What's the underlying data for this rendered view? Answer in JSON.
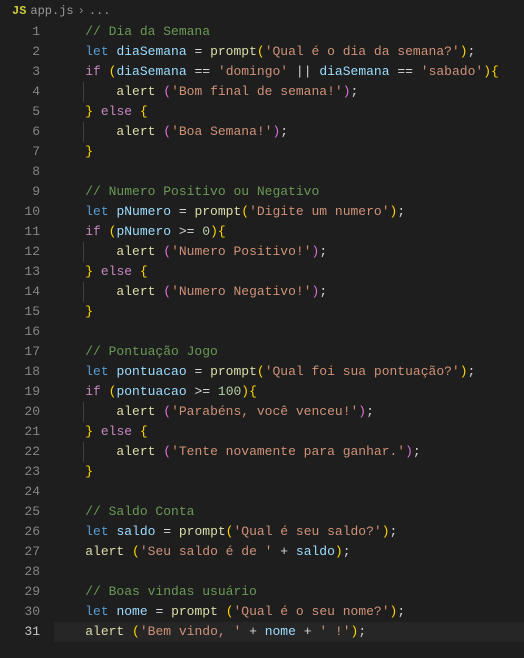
{
  "breadcrumb": {
    "js_badge": "JS",
    "filename": "app.js",
    "chevron": "›",
    "ellipsis": "..."
  },
  "lines": [
    {
      "n": 1,
      "indent": 0,
      "tokens": [
        [
          "cm",
          "// Dia da Semana"
        ]
      ]
    },
    {
      "n": 2,
      "indent": 0,
      "tokens": [
        [
          "kw",
          "let"
        ],
        [
          "op",
          " "
        ],
        [
          "vr",
          "diaSemana"
        ],
        [
          "op",
          " = "
        ],
        [
          "fn",
          "prompt"
        ],
        [
          "br-y",
          "("
        ],
        [
          "st",
          "'Qual é o dia da semana?'"
        ],
        [
          "br-y",
          ")"
        ],
        [
          "op",
          ";"
        ]
      ]
    },
    {
      "n": 3,
      "indent": 0,
      "tokens": [
        [
          "cf",
          "if"
        ],
        [
          "op",
          " "
        ],
        [
          "br-y",
          "("
        ],
        [
          "vr",
          "diaSemana"
        ],
        [
          "op",
          " == "
        ],
        [
          "st",
          "'domingo'"
        ],
        [
          "op",
          " || "
        ],
        [
          "vr",
          "diaSemana"
        ],
        [
          "op",
          " == "
        ],
        [
          "st",
          "'sabado'"
        ],
        [
          "br-y",
          ")"
        ],
        [
          "br-y",
          "{"
        ]
      ]
    },
    {
      "n": 4,
      "indent": 1,
      "tokens": [
        [
          "fn",
          "alert"
        ],
        [
          "op",
          " "
        ],
        [
          "br-p",
          "("
        ],
        [
          "st",
          "'Bom final de semana!'"
        ],
        [
          "br-p",
          ")"
        ],
        [
          "op",
          ";"
        ]
      ]
    },
    {
      "n": 5,
      "indent": 0,
      "tokens": [
        [
          "br-y",
          "}"
        ],
        [
          "op",
          " "
        ],
        [
          "cf",
          "else"
        ],
        [
          "op",
          " "
        ],
        [
          "br-y",
          "{"
        ]
      ]
    },
    {
      "n": 6,
      "indent": 1,
      "tokens": [
        [
          "fn",
          "alert"
        ],
        [
          "op",
          " "
        ],
        [
          "br-p",
          "("
        ],
        [
          "st",
          "'Boa Semana!'"
        ],
        [
          "br-p",
          ")"
        ],
        [
          "op",
          ";"
        ]
      ]
    },
    {
      "n": 7,
      "indent": 0,
      "tokens": [
        [
          "br-y",
          "}"
        ]
      ]
    },
    {
      "n": 8,
      "indent": 0,
      "tokens": []
    },
    {
      "n": 9,
      "indent": 0,
      "tokens": [
        [
          "cm",
          "// Numero Positivo ou Negativo"
        ]
      ]
    },
    {
      "n": 10,
      "indent": 0,
      "tokens": [
        [
          "kw",
          "let"
        ],
        [
          "op",
          " "
        ],
        [
          "vr",
          "pNumero"
        ],
        [
          "op",
          " = "
        ],
        [
          "fn",
          "prompt"
        ],
        [
          "br-y",
          "("
        ],
        [
          "st",
          "'Digite um numero'"
        ],
        [
          "br-y",
          ")"
        ],
        [
          "op",
          ";"
        ]
      ]
    },
    {
      "n": 11,
      "indent": 0,
      "tokens": [
        [
          "cf",
          "if"
        ],
        [
          "op",
          " "
        ],
        [
          "br-y",
          "("
        ],
        [
          "vr",
          "pNumero"
        ],
        [
          "op",
          " >= "
        ],
        [
          "nm",
          "0"
        ],
        [
          "br-y",
          ")"
        ],
        [
          "br-y",
          "{"
        ]
      ]
    },
    {
      "n": 12,
      "indent": 1,
      "tokens": [
        [
          "fn",
          "alert"
        ],
        [
          "op",
          " "
        ],
        [
          "br-p",
          "("
        ],
        [
          "st",
          "'Numero Positivo!'"
        ],
        [
          "br-p",
          ")"
        ],
        [
          "op",
          ";"
        ]
      ]
    },
    {
      "n": 13,
      "indent": 0,
      "tokens": [
        [
          "br-y",
          "}"
        ],
        [
          "op",
          " "
        ],
        [
          "cf",
          "else"
        ],
        [
          "op",
          " "
        ],
        [
          "br-y",
          "{"
        ]
      ]
    },
    {
      "n": 14,
      "indent": 1,
      "tokens": [
        [
          "fn",
          "alert"
        ],
        [
          "op",
          " "
        ],
        [
          "br-p",
          "("
        ],
        [
          "st",
          "'Numero Negativo!'"
        ],
        [
          "br-p",
          ")"
        ],
        [
          "op",
          ";"
        ]
      ]
    },
    {
      "n": 15,
      "indent": 0,
      "tokens": [
        [
          "br-y",
          "}"
        ]
      ]
    },
    {
      "n": 16,
      "indent": 0,
      "tokens": []
    },
    {
      "n": 17,
      "indent": 0,
      "tokens": [
        [
          "cm",
          "// Pontuação Jogo"
        ]
      ]
    },
    {
      "n": 18,
      "indent": 0,
      "tokens": [
        [
          "kw",
          "let"
        ],
        [
          "op",
          " "
        ],
        [
          "vr",
          "pontuacao"
        ],
        [
          "op",
          " = "
        ],
        [
          "fn",
          "prompt"
        ],
        [
          "br-y",
          "("
        ],
        [
          "st",
          "'Qual foi sua pontuação?'"
        ],
        [
          "br-y",
          ")"
        ],
        [
          "op",
          ";"
        ]
      ]
    },
    {
      "n": 19,
      "indent": 0,
      "tokens": [
        [
          "cf",
          "if"
        ],
        [
          "op",
          " "
        ],
        [
          "br-y",
          "("
        ],
        [
          "vr",
          "pontuacao"
        ],
        [
          "op",
          " >= "
        ],
        [
          "nm",
          "100"
        ],
        [
          "br-y",
          ")"
        ],
        [
          "br-y",
          "{"
        ]
      ]
    },
    {
      "n": 20,
      "indent": 1,
      "tokens": [
        [
          "fn",
          "alert"
        ],
        [
          "op",
          " "
        ],
        [
          "br-p",
          "("
        ],
        [
          "st",
          "'Parabéns, você venceu!'"
        ],
        [
          "br-p",
          ")"
        ],
        [
          "op",
          ";"
        ]
      ]
    },
    {
      "n": 21,
      "indent": 0,
      "tokens": [
        [
          "br-y",
          "}"
        ],
        [
          "op",
          " "
        ],
        [
          "cf",
          "else"
        ],
        [
          "op",
          " "
        ],
        [
          "br-y",
          "{"
        ]
      ]
    },
    {
      "n": 22,
      "indent": 1,
      "tokens": [
        [
          "fn",
          "alert"
        ],
        [
          "op",
          " "
        ],
        [
          "br-p",
          "("
        ],
        [
          "st",
          "'Tente novamente para ganhar.'"
        ],
        [
          "br-p",
          ")"
        ],
        [
          "op",
          ";"
        ]
      ]
    },
    {
      "n": 23,
      "indent": 0,
      "tokens": [
        [
          "br-y",
          "}"
        ]
      ]
    },
    {
      "n": 24,
      "indent": 0,
      "tokens": []
    },
    {
      "n": 25,
      "indent": 0,
      "tokens": [
        [
          "cm",
          "// Saldo Conta"
        ]
      ]
    },
    {
      "n": 26,
      "indent": 0,
      "tokens": [
        [
          "kw",
          "let"
        ],
        [
          "op",
          " "
        ],
        [
          "vr",
          "saldo"
        ],
        [
          "op",
          " = "
        ],
        [
          "fn",
          "prompt"
        ],
        [
          "br-y",
          "("
        ],
        [
          "st",
          "'Qual é seu saldo?'"
        ],
        [
          "br-y",
          ")"
        ],
        [
          "op",
          ";"
        ]
      ]
    },
    {
      "n": 27,
      "indent": 0,
      "tokens": [
        [
          "fn",
          "alert"
        ],
        [
          "op",
          " "
        ],
        [
          "br-y",
          "("
        ],
        [
          "st",
          "'Seu saldo é de '"
        ],
        [
          "op",
          " + "
        ],
        [
          "vr",
          "saldo"
        ],
        [
          "br-y",
          ")"
        ],
        [
          "op",
          ";"
        ]
      ]
    },
    {
      "n": 28,
      "indent": 0,
      "tokens": []
    },
    {
      "n": 29,
      "indent": 0,
      "tokens": [
        [
          "cm",
          "// Boas vindas usuário"
        ]
      ]
    },
    {
      "n": 30,
      "indent": 0,
      "tokens": [
        [
          "kw",
          "let"
        ],
        [
          "op",
          " "
        ],
        [
          "vr",
          "nome"
        ],
        [
          "op",
          " = "
        ],
        [
          "fn",
          "prompt"
        ],
        [
          "op",
          " "
        ],
        [
          "br-y",
          "("
        ],
        [
          "st",
          "'Qual é o seu nome?'"
        ],
        [
          "br-y",
          ")"
        ],
        [
          "op",
          ";"
        ]
      ]
    },
    {
      "n": 31,
      "indent": 0,
      "current": true,
      "tokens": [
        [
          "fn",
          "alert"
        ],
        [
          "op",
          " "
        ],
        [
          "br-y",
          "("
        ],
        [
          "st",
          "'Bem vindo, '"
        ],
        [
          "op",
          " + "
        ],
        [
          "vr",
          "nome"
        ],
        [
          "op",
          " + "
        ],
        [
          "st",
          "' !'"
        ],
        [
          "br-y",
          ")"
        ],
        [
          "op",
          ";"
        ]
      ]
    }
  ]
}
